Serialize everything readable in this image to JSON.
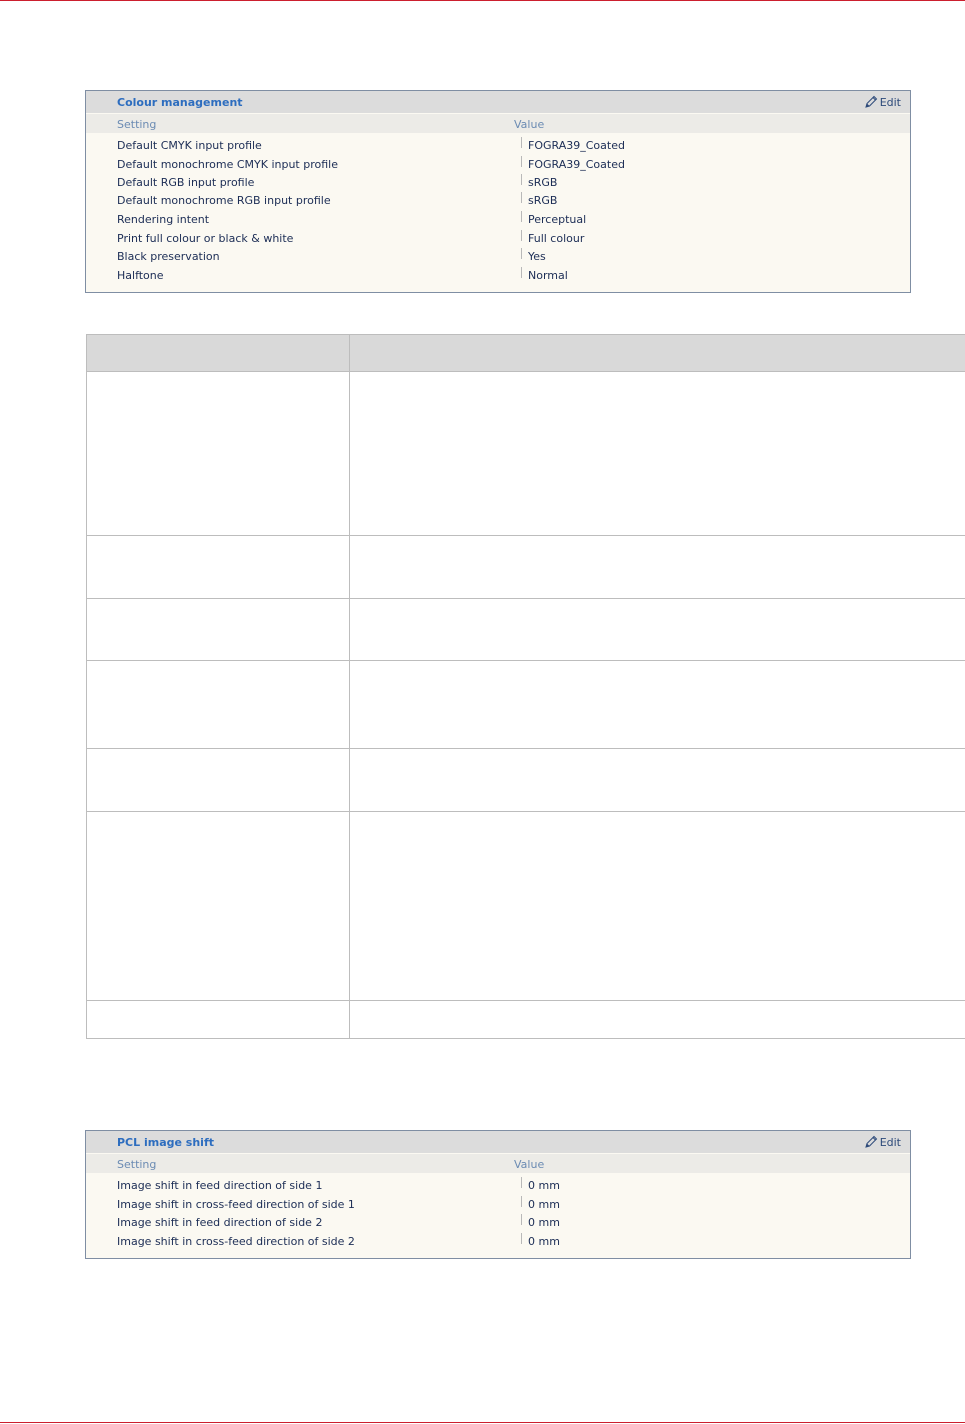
{
  "colour_management": {
    "title": "Colour management",
    "edit_label": "Edit",
    "col_setting": "Setting",
    "col_value": "Value",
    "rows": [
      {
        "setting": "Default CMYK input profile",
        "value": "FOGRA39_Coated"
      },
      {
        "setting": "Default monochrome CMYK input profile",
        "value": "FOGRA39_Coated"
      },
      {
        "setting": "Default RGB input profile",
        "value": "sRGB"
      },
      {
        "setting": "Default monochrome RGB input profile",
        "value": "sRGB"
      },
      {
        "setting": "Rendering intent",
        "value": "Perceptual"
      },
      {
        "setting": "Print full colour or black & white",
        "value": "Full colour"
      },
      {
        "setting": "Black preservation",
        "value": "Yes"
      },
      {
        "setting": "Halftone",
        "value": "Normal"
      }
    ]
  },
  "pcl_image_shift": {
    "title": "PCL image shift",
    "edit_label": "Edit",
    "col_setting": "Setting",
    "col_value": "Value",
    "rows": [
      {
        "setting": "Image shift in feed direction of side 1",
        "value": "0 mm"
      },
      {
        "setting": "Image shift in cross-feed direction of side 1",
        "value": "0 mm"
      },
      {
        "setting": "Image shift in feed direction of side 2",
        "value": "0 mm"
      },
      {
        "setting": "Image shift in cross-feed direction of side 2",
        "value": "0 mm"
      }
    ]
  },
  "colors": {
    "accent_rule": "#cc1f2e",
    "title_blue": "#2d6dbf",
    "header_grey": "#dcdcdc",
    "panel_bg": "#fbf9f2"
  },
  "icons": {
    "edit": "pencil-icon"
  }
}
